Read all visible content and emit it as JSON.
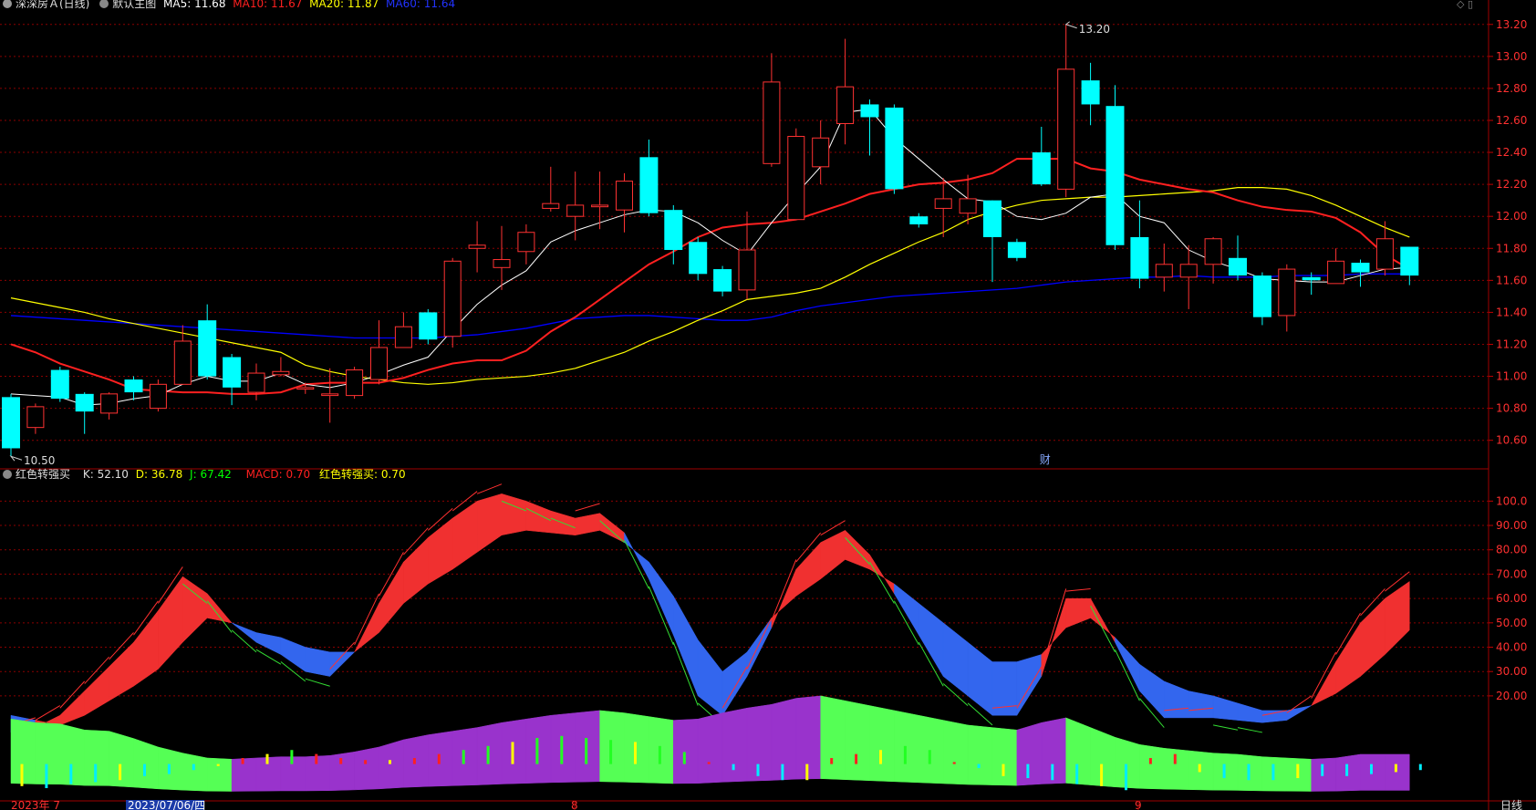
{
  "main_legend": {
    "title": "深深房Ａ(日线)",
    "chart_label": "默认主图",
    "ma5": "MA5: 11.68",
    "ma10": "MA10: 11.67",
    "ma20": "MA20: 11.87",
    "ma60": "MA60: 11.64"
  },
  "indicator_legend": {
    "name": "红色转强买",
    "k": "K: 52.10",
    "d": "D: 36.78",
    "j": "J: 67.42",
    "macd": "MACD: 0.70",
    "signal": "红色转强买: 0.70"
  },
  "annotations": {
    "high_label": "13.20",
    "low_label": "10.50",
    "marker": "财"
  },
  "date_axis": {
    "start": "2023年  7",
    "cursor_date": "2023/07/06/四",
    "aug": "8",
    "sep": "9",
    "period": "日线"
  },
  "colors": {
    "up": "#ff3232",
    "down": "#00ffff",
    "ma5": "#ffffff",
    "ma10": "#ff2020",
    "ma20": "#ffff00",
    "ma60": "#0000ff",
    "k": "#ff3232",
    "d": "#ffff00",
    "j": "#00ff00",
    "grid": "#8b0000"
  },
  "chart_data": [
    {
      "type": "candlestick",
      "title": "深深房Ａ(日线)",
      "ylim": [
        10.45,
        13.25
      ],
      "yticks": [
        "10.60",
        "10.80",
        "11.00",
        "11.20",
        "11.40",
        "11.60",
        "11.80",
        "12.00",
        "12.20",
        "12.40",
        "12.60",
        "12.80",
        "13.00",
        "13.20"
      ],
      "candles": [
        [
          10.87,
          10.55,
          10.5,
          10.89
        ],
        [
          10.68,
          10.81,
          10.64,
          10.83
        ],
        [
          11.04,
          10.86,
          10.84,
          11.06
        ],
        [
          10.89,
          10.78,
          10.64,
          10.9
        ],
        [
          10.77,
          10.89,
          10.73,
          10.9
        ],
        [
          10.98,
          10.9,
          10.85,
          11.0
        ],
        [
          10.8,
          10.95,
          10.78,
          10.98
        ],
        [
          10.95,
          11.22,
          10.95,
          11.32
        ],
        [
          11.35,
          11.0,
          10.98,
          11.45
        ],
        [
          11.12,
          10.93,
          10.82,
          11.14
        ],
        [
          10.9,
          11.02,
          10.85,
          11.08
        ],
        [
          11.01,
          11.03,
          11.0,
          11.12
        ],
        [
          10.92,
          10.93,
          10.89,
          10.96
        ],
        [
          10.88,
          10.89,
          10.71,
          11.05
        ],
        [
          10.88,
          11.04,
          10.86,
          11.06
        ],
        [
          10.98,
          11.18,
          10.95,
          11.35
        ],
        [
          11.18,
          11.31,
          11.18,
          11.4
        ],
        [
          11.4,
          11.23,
          11.2,
          11.42
        ],
        [
          11.25,
          11.72,
          11.18,
          11.74
        ],
        [
          11.8,
          11.82,
          11.65,
          11.97
        ],
        [
          11.68,
          11.73,
          11.54,
          11.94
        ],
        [
          11.78,
          11.9,
          11.7,
          11.95
        ],
        [
          12.05,
          12.08,
          12.03,
          12.31
        ],
        [
          12.0,
          12.07,
          11.85,
          12.28
        ],
        [
          12.06,
          12.07,
          11.92,
          12.28
        ],
        [
          12.04,
          12.22,
          11.9,
          12.27
        ],
        [
          12.37,
          12.02,
          12.0,
          12.48
        ],
        [
          12.04,
          11.79,
          11.7,
          12.07
        ],
        [
          11.84,
          11.64,
          11.6,
          11.87
        ],
        [
          11.67,
          11.53,
          11.5,
          11.69
        ],
        [
          11.54,
          11.79,
          11.48,
          12.03
        ],
        [
          12.33,
          12.84,
          12.31,
          13.02
        ],
        [
          11.98,
          12.5,
          11.98,
          12.55
        ],
        [
          12.31,
          12.49,
          12.2,
          12.6
        ],
        [
          12.58,
          12.81,
          12.45,
          13.11
        ],
        [
          12.7,
          12.62,
          12.38,
          12.73
        ],
        [
          12.68,
          12.17,
          12.14,
          12.7
        ],
        [
          12.0,
          11.95,
          11.93,
          12.02
        ],
        [
          12.05,
          12.11,
          11.87,
          12.24
        ],
        [
          12.02,
          12.11,
          11.95,
          12.26
        ],
        [
          12.1,
          11.87,
          11.59,
          12.1
        ],
        [
          11.84,
          11.74,
          11.72,
          11.86
        ],
        [
          12.4,
          12.2,
          12.19,
          12.56
        ],
        [
          12.17,
          12.92,
          12.12,
          13.2
        ],
        [
          12.85,
          12.7,
          12.57,
          12.96
        ],
        [
          12.69,
          11.82,
          11.79,
          12.82
        ],
        [
          11.87,
          11.61,
          11.55,
          12.1
        ],
        [
          11.62,
          11.7,
          11.53,
          11.83
        ],
        [
          11.62,
          11.7,
          11.42,
          11.82
        ],
        [
          11.7,
          11.86,
          11.58,
          11.87
        ],
        [
          11.74,
          11.63,
          11.6,
          11.88
        ],
        [
          11.63,
          11.37,
          11.32,
          11.65
        ],
        [
          11.38,
          11.67,
          11.28,
          11.7
        ],
        [
          11.62,
          11.6,
          11.51,
          11.65
        ],
        [
          11.58,
          11.72,
          11.58,
          11.8
        ],
        [
          11.71,
          11.65,
          11.56,
          11.73
        ],
        [
          11.67,
          11.86,
          11.63,
          11.97
        ],
        [
          11.81,
          11.63,
          11.57,
          11.81
        ]
      ],
      "ma5": [
        10.89,
        10.88,
        10.87,
        10.82,
        10.83,
        10.86,
        10.88,
        10.95,
        11.0,
        10.97,
        10.97,
        11.02,
        10.95,
        10.93,
        10.96,
        11.01,
        11.07,
        11.12,
        11.29,
        11.45,
        11.57,
        11.66,
        11.84,
        11.91,
        11.96,
        12.01,
        12.04,
        12.03,
        11.96,
        11.85,
        11.76,
        11.96,
        12.14,
        12.31,
        12.65,
        12.67,
        12.49,
        12.36,
        12.23,
        12.11,
        12.09,
        12.0,
        11.98,
        12.02,
        12.12,
        12.14,
        12.0,
        11.96,
        11.79,
        11.72,
        11.67,
        11.61,
        11.6,
        11.59,
        11.59,
        11.63,
        11.67,
        11.68
      ],
      "ma10": [
        11.2,
        11.15,
        11.08,
        11.03,
        10.98,
        10.92,
        10.91,
        10.9,
        10.9,
        10.89,
        10.89,
        10.9,
        10.95,
        10.96,
        10.96,
        10.96,
        10.99,
        11.04,
        11.08,
        11.1,
        11.1,
        11.16,
        11.28,
        11.37,
        11.48,
        11.59,
        11.7,
        11.78,
        11.87,
        11.93,
        11.95,
        11.96,
        11.98,
        12.03,
        12.08,
        12.14,
        12.17,
        12.2,
        12.21,
        12.23,
        12.27,
        12.36,
        12.36,
        12.36,
        12.3,
        12.28,
        12.23,
        12.2,
        12.17,
        12.15,
        12.1,
        12.06,
        12.04,
        12.03,
        11.99,
        11.9,
        11.76,
        11.67
      ],
      "ma20": [
        11.49,
        11.46,
        11.43,
        11.4,
        11.36,
        11.33,
        11.3,
        11.27,
        11.24,
        11.21,
        11.18,
        11.15,
        11.07,
        11.03,
        11.0,
        10.98,
        10.96,
        10.95,
        10.96,
        10.98,
        10.99,
        11.0,
        11.02,
        11.05,
        11.1,
        11.15,
        11.22,
        11.28,
        11.35,
        11.41,
        11.48,
        11.5,
        11.52,
        11.55,
        11.62,
        11.7,
        11.77,
        11.84,
        11.9,
        11.98,
        12.03,
        12.07,
        12.1,
        12.11,
        12.12,
        12.12,
        12.13,
        12.14,
        12.15,
        12.16,
        12.18,
        12.18,
        12.17,
        12.13,
        12.07,
        12.0,
        11.93,
        11.87
      ],
      "ma60": [
        11.38,
        11.37,
        11.36,
        11.35,
        11.34,
        11.33,
        11.32,
        11.31,
        11.3,
        11.29,
        11.28,
        11.27,
        11.26,
        11.25,
        11.24,
        11.24,
        11.24,
        11.24,
        11.25,
        11.26,
        11.28,
        11.3,
        11.33,
        11.36,
        11.37,
        11.38,
        11.38,
        11.37,
        11.36,
        11.35,
        11.35,
        11.37,
        11.41,
        11.44,
        11.46,
        11.48,
        11.5,
        11.51,
        11.52,
        11.53,
        11.54,
        11.55,
        11.57,
        11.59,
        11.6,
        11.61,
        11.62,
        11.62,
        11.63,
        11.62,
        11.62,
        11.62,
        11.63,
        11.63,
        11.63,
        11.64,
        11.64,
        11.64
      ]
    },
    {
      "type": "indicator",
      "title": "红色转强买",
      "ylim": [
        -22,
        108
      ],
      "yticks": [
        "20.00",
        "30.00",
        "40.00",
        "50.00",
        "60.00",
        "70.00",
        "80.00",
        "90.00",
        "100.0"
      ],
      "fast": [
        5,
        7,
        12,
        22,
        32,
        42,
        55,
        69,
        62,
        50,
        42,
        37,
        30,
        28,
        38,
        58,
        75,
        85,
        93,
        100,
        103,
        100,
        96,
        93,
        95,
        87,
        68,
        45,
        20,
        12,
        28,
        48,
        72,
        83,
        88,
        78,
        62,
        45,
        28,
        20,
        12,
        12,
        28,
        60,
        60,
        42,
        22,
        11,
        11,
        11,
        10,
        9,
        10,
        16,
        34,
        50,
        60,
        67
      ],
      "slow": [
        12,
        10,
        8,
        12,
        18,
        24,
        31,
        42,
        52,
        50,
        46,
        44,
        40,
        38,
        38,
        46,
        58,
        66,
        72,
        79,
        86,
        88,
        87,
        86,
        88,
        83,
        75,
        61,
        43,
        30,
        38,
        52,
        61,
        68,
        76,
        72,
        66,
        58,
        50,
        42,
        34,
        34,
        37,
        48,
        52,
        44,
        33,
        26,
        22,
        20,
        17,
        14,
        14,
        16,
        21,
        28,
        37,
        47
      ],
      "band": [
        10.5,
        9,
        8.5,
        6,
        5.5,
        2.5,
        -1,
        -3.5,
        -5.5,
        -6,
        -5.5,
        -5,
        -5,
        -4.5,
        -3,
        -1,
        2,
        4,
        5.5,
        7,
        9,
        10.5,
        12,
        13,
        14,
        13,
        11.5,
        10,
        10.5,
        13,
        15,
        16.5,
        19,
        20,
        18,
        16,
        14,
        12,
        10,
        8,
        7,
        6,
        9,
        11,
        7,
        3,
        0,
        -1.5,
        -2.5,
        -3.5,
        -4,
        -5,
        -5.5,
        -6,
        -5.5,
        -4,
        -4,
        -4
      ],
      "macd_bars": [
        -11,
        -12,
        -10,
        -9,
        -8,
        -6,
        -5,
        -3,
        -1,
        3,
        5,
        7,
        5,
        3,
        2,
        2,
        3,
        5,
        7,
        9,
        11,
        13,
        14,
        13,
        12,
        11,
        9,
        6,
        1,
        -3,
        -6,
        -8,
        -8,
        3,
        5,
        7,
        9,
        7,
        1,
        -2,
        -6,
        -7,
        -8,
        -10,
        -11,
        -13,
        3,
        5,
        -4,
        -7,
        -8,
        -8,
        -7,
        -6,
        -6,
        -5,
        -4,
        -3,
        -2,
        2,
        2
      ]
    }
  ]
}
